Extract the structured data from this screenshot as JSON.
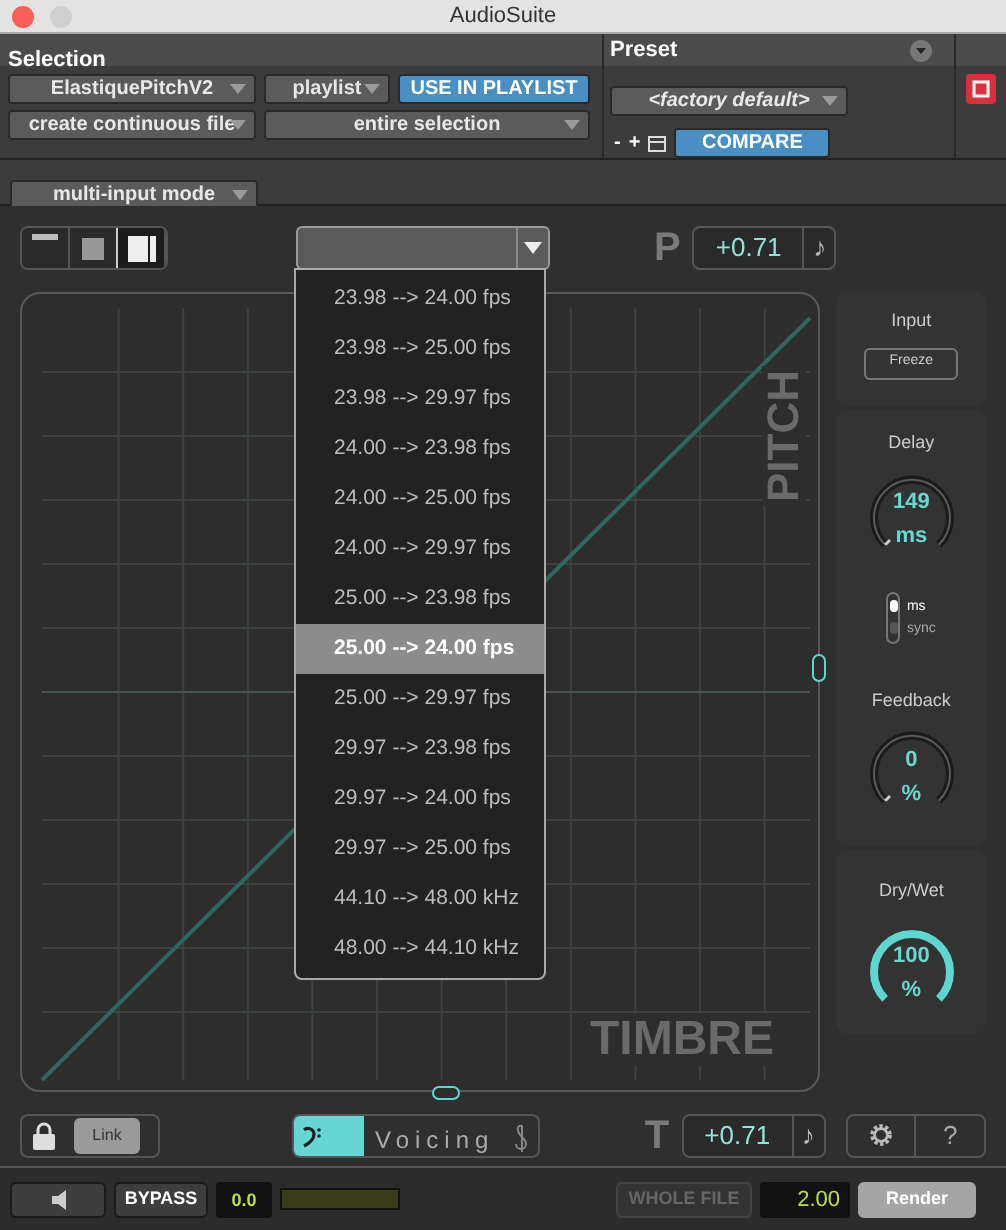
{
  "window": {
    "title": "AudioSuite"
  },
  "selection": {
    "label": "Selection",
    "plugin": "ElastiquePitchV2",
    "target": "playlist",
    "use_in_playlist": "USE IN PLAYLIST",
    "file_mode": "create continuous file",
    "range": "entire selection",
    "input_mode": "multi-input mode"
  },
  "preset": {
    "label": "Preset",
    "name": "<factory default>",
    "minus": "-",
    "plus": "+",
    "compare": "COMPARE"
  },
  "view_modes": [
    {
      "selected": false
    },
    {
      "selected": false
    },
    {
      "selected": true
    }
  ],
  "ratio_menu": {
    "items": [
      {
        "label": "23.98 --> 24.00 fps",
        "selected": false
      },
      {
        "label": "23.98 --> 25.00 fps",
        "selected": false
      },
      {
        "label": "23.98 --> 29.97 fps",
        "selected": false
      },
      {
        "label": "24.00 --> 23.98 fps",
        "selected": false
      },
      {
        "label": "24.00 --> 25.00 fps",
        "selected": false
      },
      {
        "label": "24.00 --> 29.97 fps",
        "selected": false
      },
      {
        "label": "25.00 --> 23.98 fps",
        "selected": false
      },
      {
        "label": "25.00 --> 24.00 fps",
        "selected": true
      },
      {
        "label": "25.00 --> 29.97 fps",
        "selected": false
      },
      {
        "label": "29.97 --> 23.98 fps",
        "selected": false
      },
      {
        "label": "29.97 --> 24.00 fps",
        "selected": false
      },
      {
        "label": "29.97 --> 25.00 fps",
        "selected": false
      },
      {
        "label": "44.10 --> 48.00 kHz",
        "selected": false
      },
      {
        "label": "48.00 --> 44.10 kHz",
        "selected": false
      }
    ]
  },
  "pitch": {
    "letter": "P",
    "value": "+0.71",
    "note": "♪"
  },
  "graph": {
    "pitch_label": "PITCH",
    "timbre_label": "TIMBRE"
  },
  "input": {
    "label": "Input",
    "freeze": "Freeze"
  },
  "delay": {
    "label": "Delay",
    "value": "149",
    "unit": "ms"
  },
  "sync_mode": [
    {
      "label": "ms",
      "selected": true
    },
    {
      "label": "sync",
      "selected": false
    }
  ],
  "feedback": {
    "label": "Feedback",
    "value": "0",
    "unit": "%"
  },
  "dry_wet": {
    "label": "Dry/Wet",
    "value": "100",
    "unit": "%",
    "level": 1
  },
  "link": {
    "label": "Link"
  },
  "voicing": {
    "label": "Voicing",
    "level": 0.28
  },
  "timbre": {
    "letter": "T",
    "value": "+0.71",
    "note": "♪"
  },
  "help": "?",
  "status_bar": {
    "bypass": "BYPASS",
    "level_value": "0.0",
    "whole_file": "WHOLE FILE",
    "handle": "2.00",
    "render": "Render"
  }
}
